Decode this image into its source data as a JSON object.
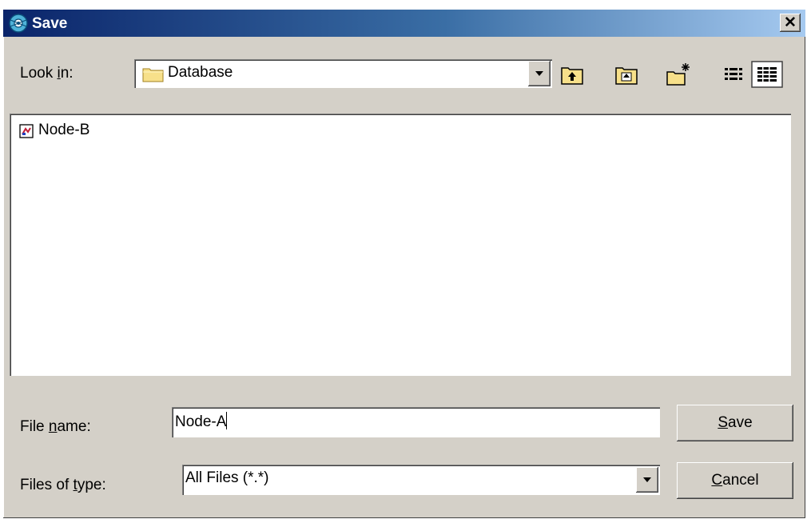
{
  "window": {
    "title": "Save"
  },
  "look_in": {
    "label_pre": "Look ",
    "label_key": "i",
    "label_post": "n:",
    "value": "Database"
  },
  "toolbar": {
    "icons": [
      "up-one-level-icon",
      "desktop-icon",
      "create-new-folder-icon",
      "list-view-icon",
      "details-view-icon"
    ]
  },
  "files": [
    {
      "name": "Node-B",
      "icon": "file-icon"
    }
  ],
  "file_name": {
    "label_pre": "File ",
    "label_key": "n",
    "label_post": "ame:",
    "value": "Node-A"
  },
  "file_type": {
    "label_pre": "Files of ",
    "label_key": "t",
    "label_post": "ype:",
    "value": "All Files (*.*)"
  },
  "buttons": {
    "save_key": "S",
    "save_rest": "ave",
    "cancel_key": "C",
    "cancel_rest": "ancel"
  },
  "colors": {
    "titlebar_start": "#0a246a",
    "titlebar_end": "#a6caf0",
    "dialog_face": "#d4d0c8"
  }
}
